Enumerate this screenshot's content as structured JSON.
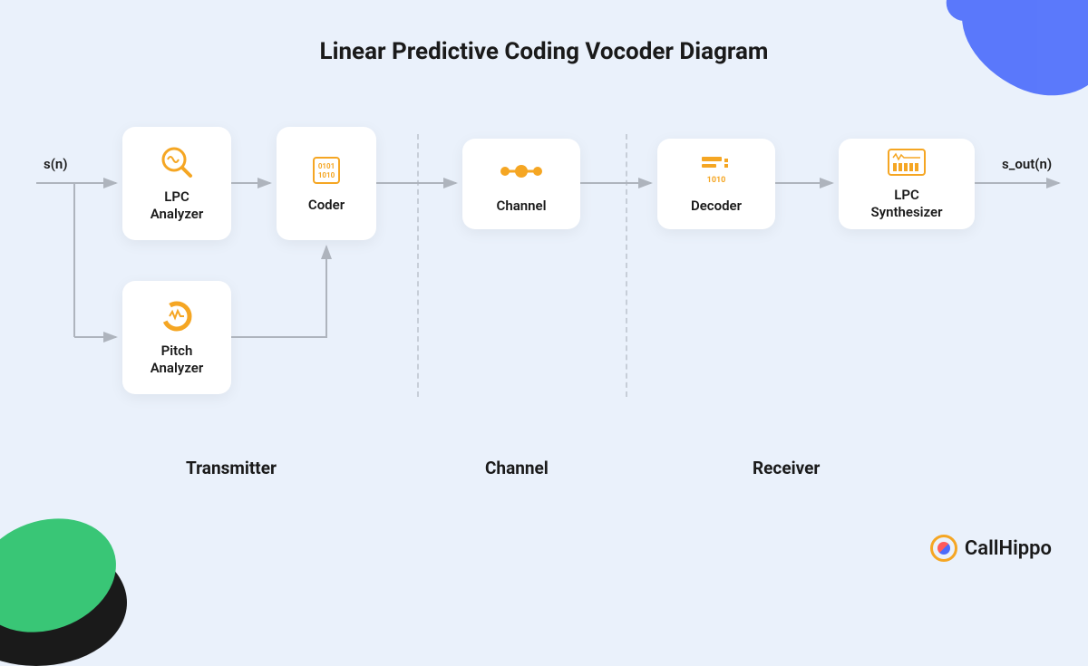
{
  "title": "Linear Predictive Coding Vocoder Diagram",
  "input_label": "s(n)",
  "output_label": "s_out(n)",
  "blocks": {
    "lpc_analyzer": "LPC\nAnalyzer",
    "pitch_analyzer": "Pitch\nAnalyzer",
    "coder": "Coder",
    "channel": "Channel",
    "decoder": "Decoder",
    "lpc_synth": "LPC\nSynthesizer"
  },
  "sections": {
    "transmitter": "Transmitter",
    "channel": "Channel",
    "receiver": "Receiver"
  },
  "brand": "CallHippo",
  "colors": {
    "accent": "#f5a623",
    "bg": "#eaf1fb",
    "arrow": "#aeb4bd"
  }
}
